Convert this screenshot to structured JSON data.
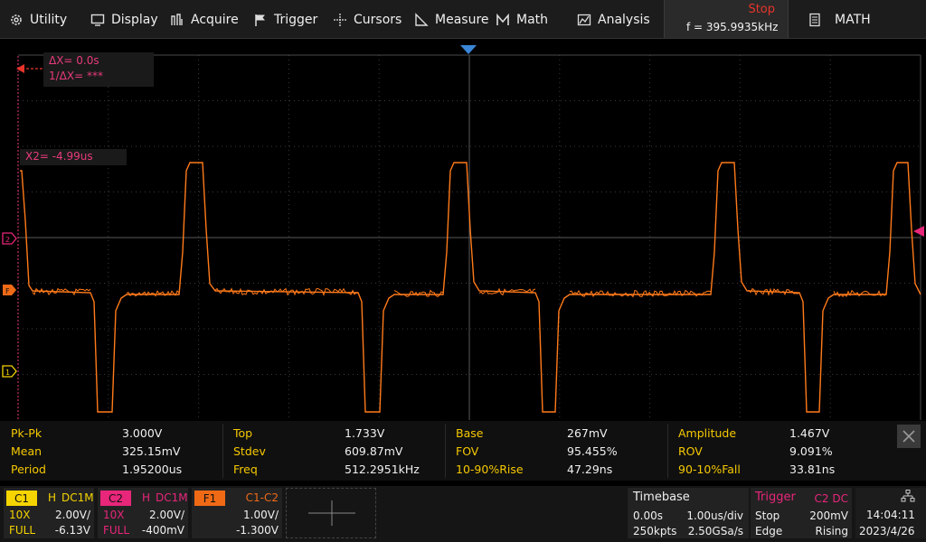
{
  "menu": {
    "utility": "Utility",
    "display": "Display",
    "acquire": "Acquire",
    "trigger": "Trigger",
    "cursors": "Cursors",
    "measure": "Measure",
    "math": "Math",
    "analysis": "Analysis",
    "run_state": "Stop",
    "frequency": "f = 395.9935kHz",
    "math_right": "MATH"
  },
  "cursors": {
    "delta_x": "ΔX= 0.0s",
    "inv_delta_x": "1/ΔX= ***",
    "x2": "X2= -4.99us"
  },
  "measurements": [
    {
      "label": "Pk-Pk",
      "value": "3.000V"
    },
    {
      "label": "Top",
      "value": "1.733V"
    },
    {
      "label": "Base",
      "value": "267mV"
    },
    {
      "label": "Amplitude",
      "value": "1.467V"
    },
    {
      "label": "Mean",
      "value": "325.15mV"
    },
    {
      "label": "Stdev",
      "value": "609.87mV"
    },
    {
      "label": "FOV",
      "value": "95.455%"
    },
    {
      "label": "ROV",
      "value": "9.091%"
    },
    {
      "label": "Period",
      "value": "1.95200us"
    },
    {
      "label": "Freq",
      "value": "512.2951kHz"
    },
    {
      "label": "10-90%Rise",
      "value": "47.29ns"
    },
    {
      "label": "90-10%Fall",
      "value": "33.81ns"
    }
  ],
  "channels": {
    "c1": {
      "tag": "C1",
      "bw": "H",
      "coupling": "DC1M",
      "probe": "10X",
      "scale": "2.00V/",
      "bwlimit": "FULL",
      "offset": "-6.13V"
    },
    "c2": {
      "tag": "C2",
      "bw": "H",
      "coupling": "DC1M",
      "probe": "10X",
      "scale": "2.00V/",
      "bwlimit": "FULL",
      "offset": "-400mV"
    },
    "f1": {
      "tag": "F1",
      "source": "C1-C2",
      "scale": "1.00V/",
      "offset": "-1.300V"
    }
  },
  "timebase": {
    "title": "Timebase",
    "delay": "0.00s",
    "scale": "1.00us/div",
    "memory": "250kpts",
    "sample_rate": "2.50GSa/s"
  },
  "trigger": {
    "title": "Trigger",
    "source": "C2 DC",
    "mode": "Stop",
    "level": "200mV",
    "type": "Edge",
    "slope": "Rising"
  },
  "clock": {
    "time": "14:04:11",
    "date": "2023/4/26"
  },
  "colors": {
    "c1": "#f6d400",
    "c2": "#e8267a",
    "f1": "#f06a16",
    "waveform": "#ff7a1a",
    "stop": "#e8342b"
  }
}
